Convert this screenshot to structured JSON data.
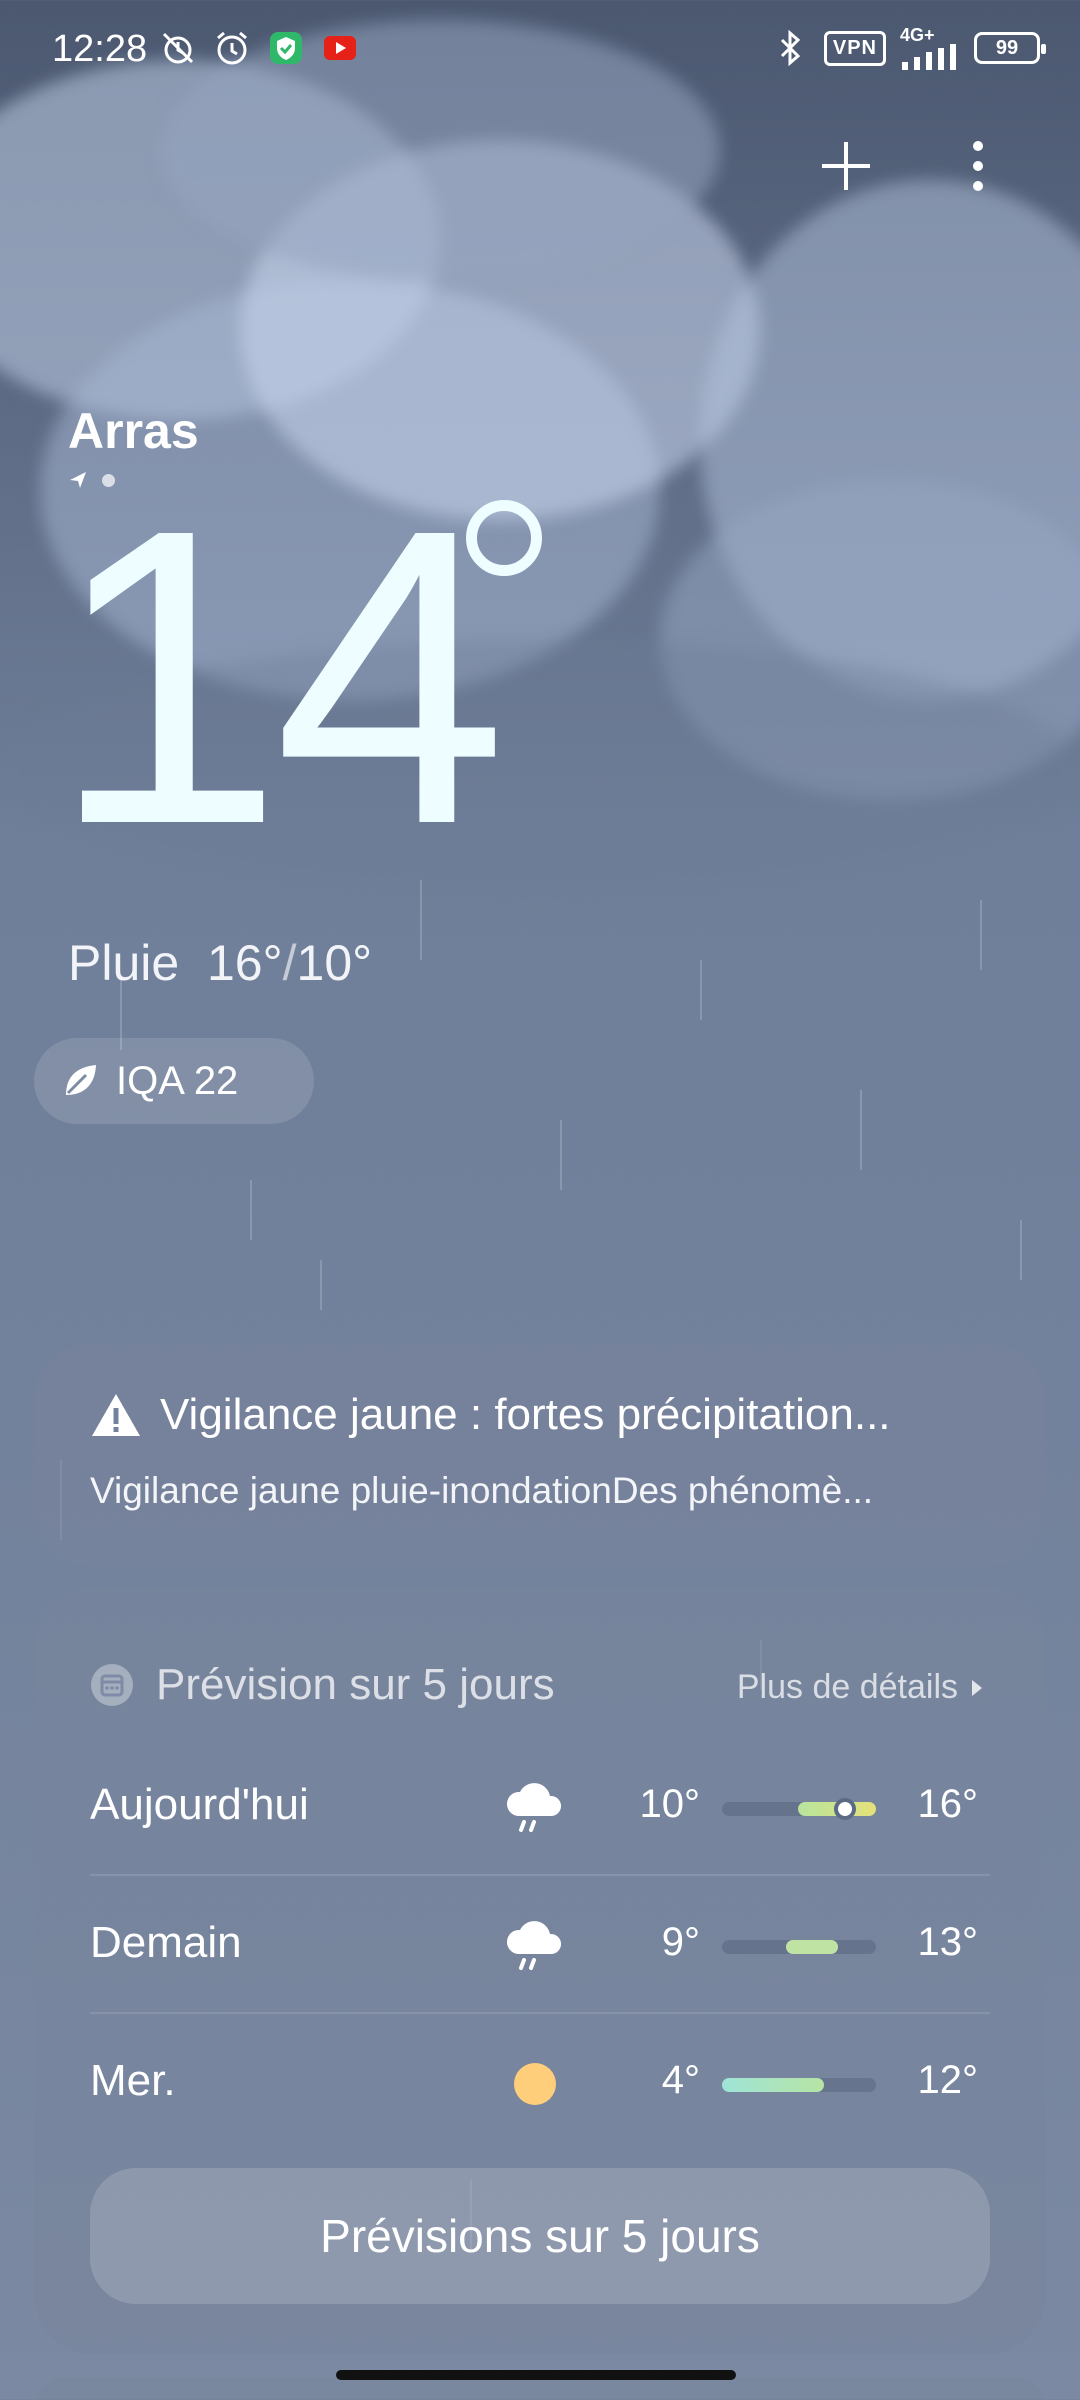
{
  "status_bar": {
    "time": "12:28",
    "vpn": "VPN",
    "network": "4G+",
    "battery": "99"
  },
  "location": {
    "city": "Arras"
  },
  "current": {
    "temperature": "14",
    "condition": "Pluie",
    "high": "16°",
    "low": "10°",
    "aqi": "IQA 22"
  },
  "alert": {
    "title": "Vigilance jaune : fortes précipitation...",
    "description": "Vigilance jaune pluie-inondationDes phénomè..."
  },
  "forecast": {
    "heading": "Prévision sur 5 jours",
    "more_label": "Plus de détails",
    "button_label": "Prévisions sur 5 jours",
    "days": [
      {
        "label": "Aujourd'hui",
        "icon": "rain-cloud-icon",
        "low": "10°",
        "high": "16°"
      },
      {
        "label": "Demain",
        "icon": "rain-cloud-icon",
        "low": "9°",
        "high": "13°"
      },
      {
        "label": "Mer.",
        "icon": "sun-icon",
        "low": "4°",
        "high": "12°"
      }
    ]
  },
  "colors": {
    "bar_today": "#cde4a6",
    "bar_tomorrow": "#bfe3a3",
    "bar_wed": "#9ee4d8",
    "sun": "#ffce7a"
  }
}
